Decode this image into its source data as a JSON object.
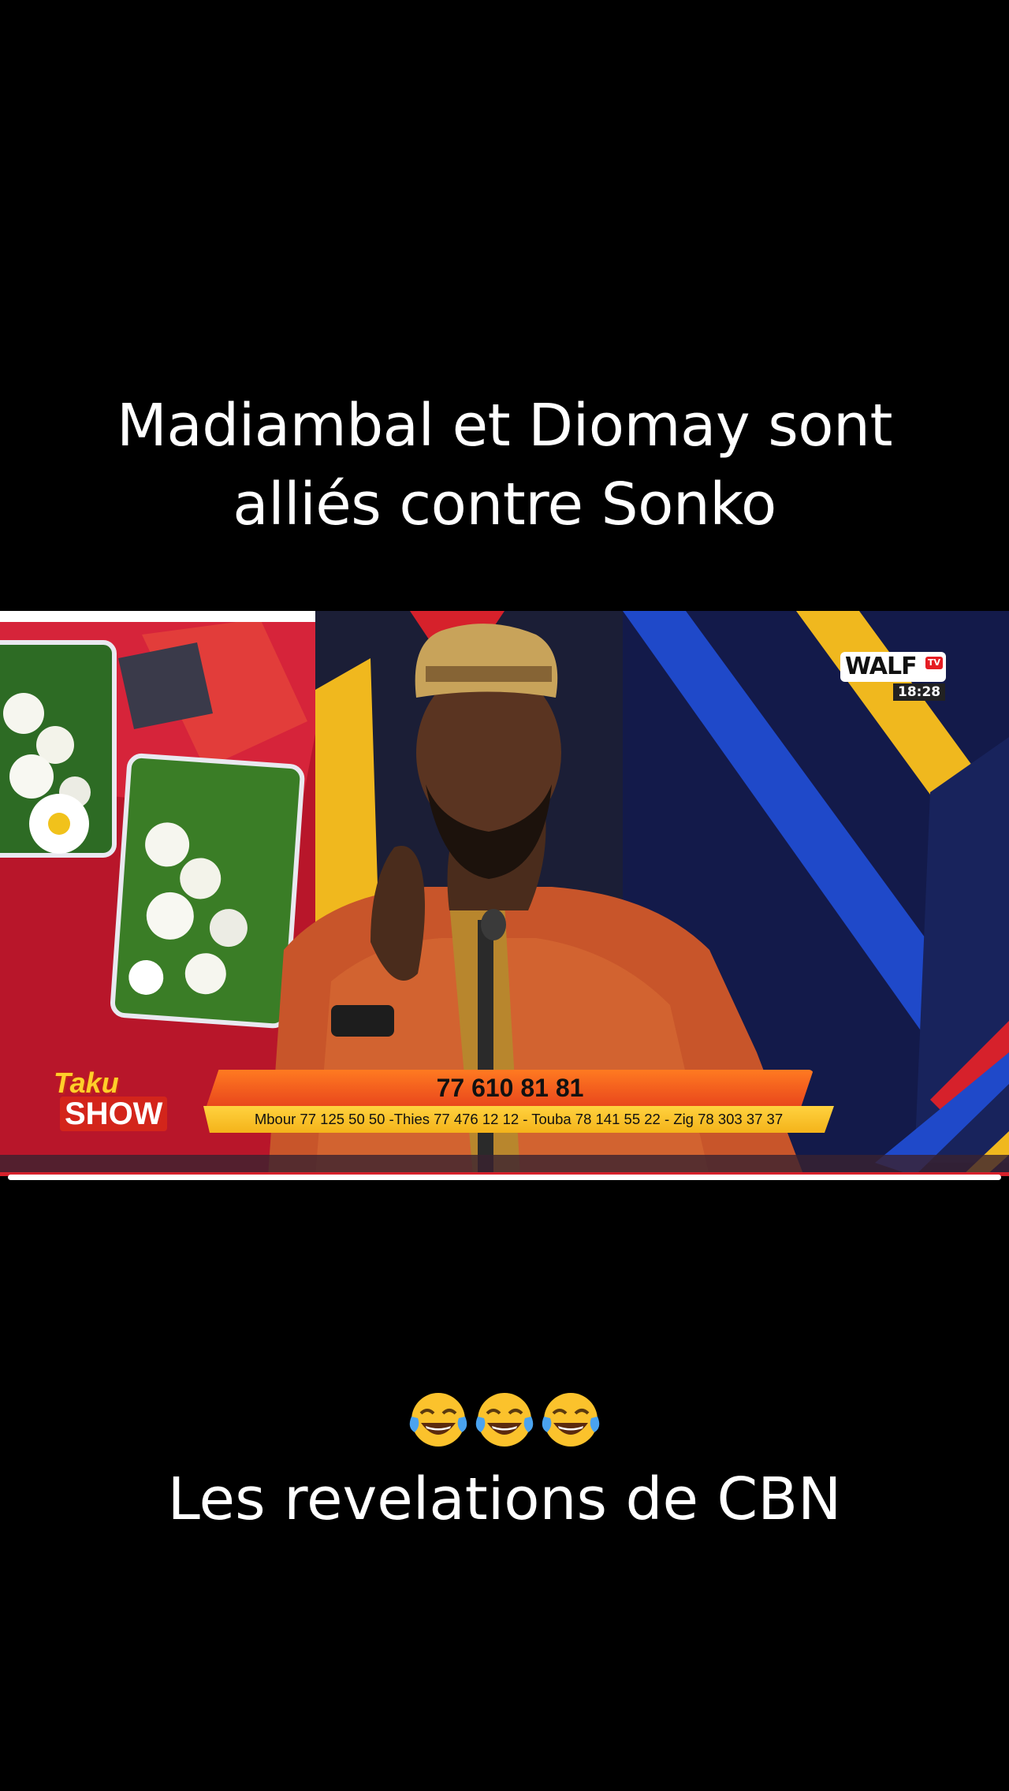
{
  "caption_top": {
    "line1": "Madiambal et Diomay sont",
    "line2": "alliés contre Sonko"
  },
  "video": {
    "channel_logo": "WALF",
    "channel_logo_badge": "TV",
    "clock": "18:28",
    "phone_number": "77 610 81 81",
    "regional_numbers": "Mbour 77 125 50 50 -Thies 77 476 12 12 - Touba 78 141 55 22 - Zig 78 303 37 37",
    "show_logo_line1": "Taku",
    "show_logo_line2": "SHOW",
    "progress_fraction": 1.0
  },
  "emoji": {
    "name": "face-with-tears-of-joy-icon",
    "count": 3
  },
  "caption_bottom": "Les revelations de CBN",
  "colors": {
    "background": "#000000",
    "caption": "#ffffff",
    "phone_bar": "#e9471c",
    "regions_bar": "#f4b31a",
    "studio_blue": "#1f49c9",
    "studio_yellow": "#f0b81e",
    "studio_red": "#d6212b"
  }
}
